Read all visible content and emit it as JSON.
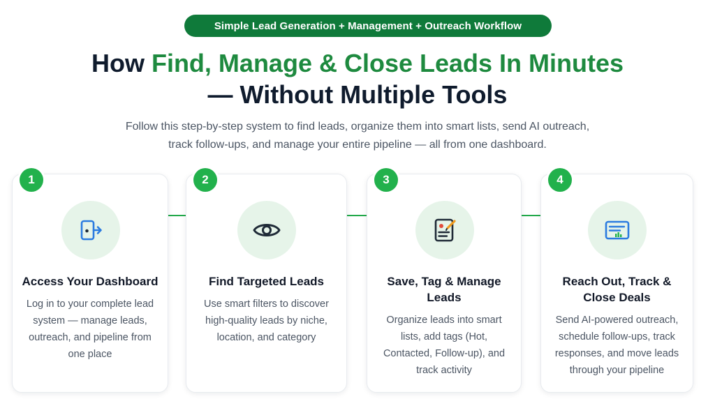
{
  "header": {
    "pill": "Simple Lead Generation + Management + Outreach Workflow",
    "title_prefix": "How ",
    "title_highlight": "Find, Manage & Close Leads In Minutes",
    "title_line2": "— Without Multiple Tools",
    "subtitle_line1": "Follow this step-by-step system to find leads, organize them into smart lists, send AI outreach,",
    "subtitle_line2": "track follow-ups, and manage your entire pipeline — all from one dashboard."
  },
  "steps": [
    {
      "number": "1",
      "icon": "login-door-icon",
      "title": "Access Your Dashboard",
      "description": "Log in to your complete lead system — manage leads, outreach, and pipeline from one place"
    },
    {
      "number": "2",
      "icon": "eye-icon",
      "title": "Find Targeted Leads",
      "description": "Use smart filters to discover high-quality leads by niche, location, and category"
    },
    {
      "number": "3",
      "icon": "edit-document-icon",
      "title": "Save, Tag & Manage Leads",
      "description": "Organize leads into smart lists, add tags (Hot, Contacted, Follow-up), and track activity"
    },
    {
      "number": "4",
      "icon": "dashboard-screen-icon",
      "title": "Reach Out, Track & Close Deals",
      "description": "Send AI-powered outreach, schedule follow-ups, track responses, and move leads through your pipeline"
    }
  ],
  "colors": {
    "brand_green": "#22b14c",
    "dark_green": "#0f7a3a",
    "icon_blue": "#2b7be0",
    "icon_dark": "#1f2a37"
  }
}
